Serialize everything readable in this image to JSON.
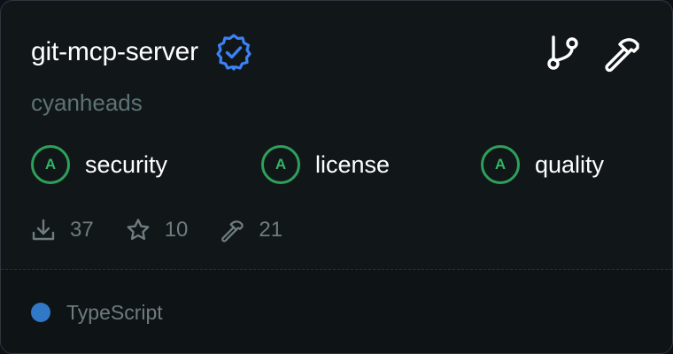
{
  "repo": {
    "name": "git-mcp-server",
    "owner": "cyanheads"
  },
  "icons": {
    "verified": "verified-badge-icon",
    "fork": "git-branch-icon",
    "tools": "hammer-icon",
    "downloads": "download-icon",
    "stars": "star-icon",
    "tool_count": "hammer-icon"
  },
  "grades": [
    {
      "grade": "A",
      "label": "security"
    },
    {
      "grade": "A",
      "label": "license"
    },
    {
      "grade": "A",
      "label": "quality"
    }
  ],
  "stats": {
    "downloads": "37",
    "stars": "10",
    "tools": "21"
  },
  "language": {
    "name": "TypeScript",
    "color": "#3178c6"
  },
  "colors": {
    "accent_blue": "#3b82f6",
    "grade_green": "#2ea05a",
    "owner_text": "#5d7277"
  }
}
